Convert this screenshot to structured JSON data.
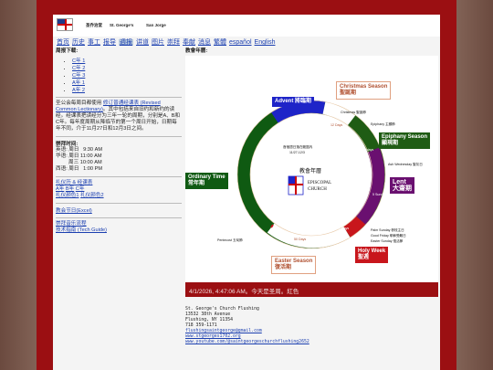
{
  "header": {
    "name_zh": "圣乔治堂",
    "name_en": "St. George's",
    "name_es": "San Jorge"
  },
  "nav": [
    "首页",
    "历史",
    "事工",
    "报导",
    "週报",
    "讲道",
    "图片",
    "崇拜",
    "奉献",
    "消息",
    "繁體",
    "español",
    "English"
  ],
  "left": {
    "weekly_label": "周报下载:",
    "weekly_links": [
      "C年 1",
      "C年 2",
      "C年 3",
      "A年 1",
      "A年 2"
    ],
    "lect_text_1": "圣公会每周目都使用",
    "lect_link": "修订普通经课表 (Revised Common Lectionary)",
    "lect_text_2": "。其中包括来自旧约和新约的读经。经课表把读经分为三年一轮的周期，分别是A、B和C年。每年度周期从降临节的第一个周日开始，日期每年不同，介于11月27日和12月3日之间。",
    "worship_label": "崇拜时间:",
    "schedule": [
      "英语: 周日   9:30 AM",
      "华语: 周日 11:00 AM",
      "         周三 10:00 AM",
      "西语: 周日   1:00 PM"
    ],
    "calendar_link": "礼仪历 & 经课表",
    "calendar_years": [
      "A年",
      "B年",
      "C年"
    ],
    "color_links": [
      "礼仪颜色1",
      "礼仪颜色2"
    ],
    "excel_link": "教会节日(Excel)",
    "music_link": "崇拜音乐流程",
    "tech_link": "技术指南 (Tech Guide)"
  },
  "main": {
    "year_title": "教會年曆:",
    "wheel": {
      "center": "教會年曆",
      "advent": "Advent 將臨期",
      "advent_weeks": "4 Sundays",
      "advent_note1": "首個週日落在範圍內",
      "advent_note2": "11/27-12/3",
      "christmas_title": "Christmas Season",
      "christmas_zh": "聖誕期",
      "christmas_day": "Christmas 聖誕節",
      "twelve_days": "12 Days",
      "epiphany_day": "Epiphany 主顯節",
      "epiphany_title": "Epiphany Season",
      "epiphany_zh": "顯現期",
      "epiphany_weeks": "4-9 Sundays",
      "ash": "Ash Wednesday 聖灰日",
      "lent_title": "Lent",
      "lent_zh": "大齋期",
      "lent_weeks": "5 Sundays",
      "seven_days": "7 Days",
      "palm": "Palm Sunday 棕枝主日",
      "friday": "Good Friday 耶穌受難日",
      "easter_day": "Easter Sunday 復活節",
      "holy_week_title": "Holy Week",
      "holy_week_zh": "聖週",
      "fifty_days": "50 Days",
      "pentecost": "Pentecost 五旬節",
      "easter_title": "Easter Season",
      "easter_zh": "復活期",
      "ordinary_title": "Ordinary Time",
      "ordinary_zh": "常年期",
      "logo_line1": "EPISCOPAL",
      "logo_line2": "CHURCH"
    },
    "date_line": "4/1/2026, 4:47:06 AM。今天是圣周。紅色"
  },
  "footer": {
    "name": "St. George's Church Flushing",
    "addr1": "13532 38th Avenue",
    "addr2": "Flushing, NY 11354",
    "phone": "718 359-1171",
    "email": "flushingsaintgeorge@gmail.com",
    "site": "www.stgeorges1702.org",
    "youtube": "www.youtube.com/@saintgeorgeschurchflushing2652"
  },
  "colors": {
    "frame": "#9b0f12",
    "advent": "#1e24c8",
    "epiphany": "#1f5c14",
    "ordinary": "#0f5a12",
    "lent": "#6a1070",
    "holyweek": "#c8161c",
    "easter_ring": "#ffffff"
  }
}
